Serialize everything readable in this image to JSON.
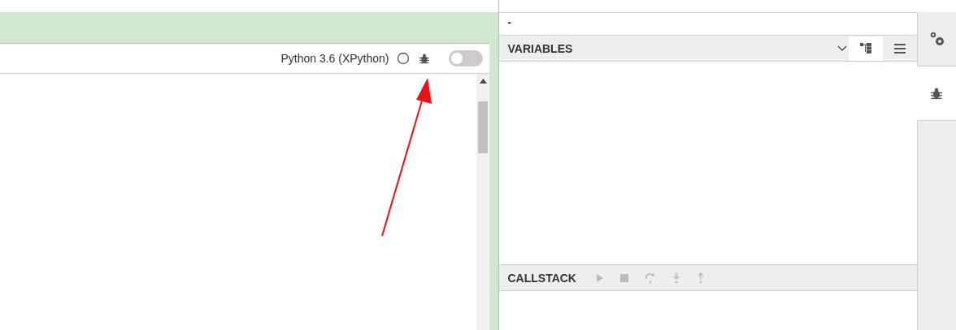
{
  "notebook": {
    "kernel": "Python 3.6 (XPython)",
    "kernel_busy": false,
    "debug_toggle": {
      "on": false
    }
  },
  "debugger": {
    "thread": "-",
    "variables": {
      "title": "VARIABLES",
      "views": [
        {
          "kind": "tree",
          "selected": true
        },
        {
          "kind": "table",
          "selected": false
        }
      ]
    },
    "callstack": {
      "title": "CALLSTACK"
    }
  },
  "sidebar_tabs": [
    {
      "kind": "settings",
      "selected": false
    },
    {
      "kind": "debugger",
      "selected": true
    }
  ]
}
